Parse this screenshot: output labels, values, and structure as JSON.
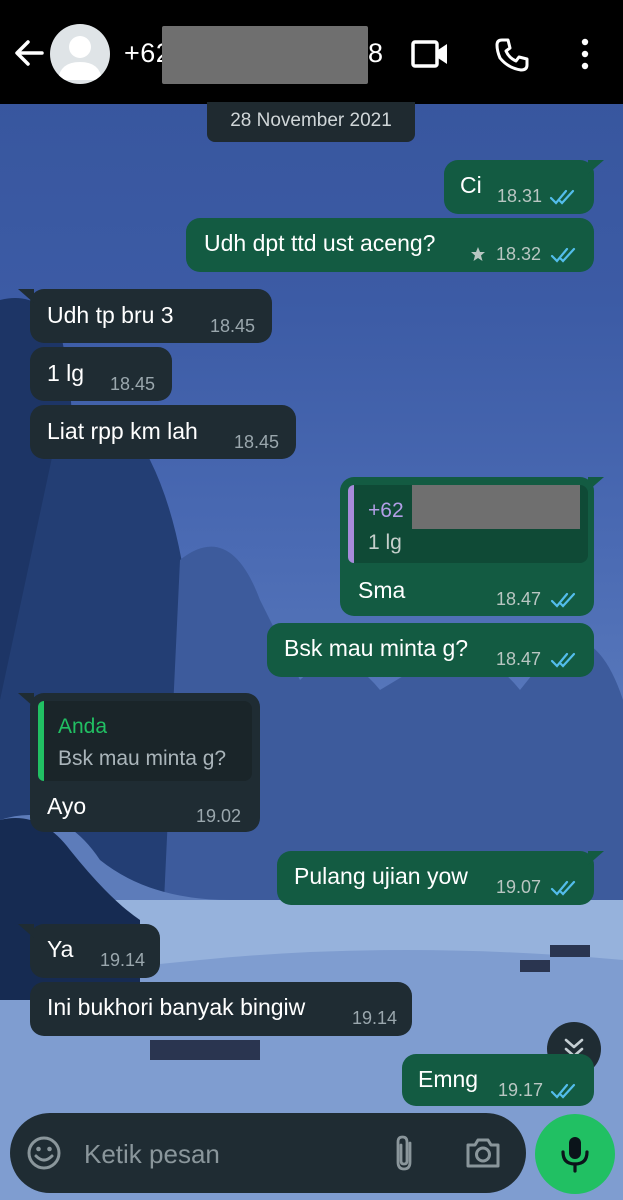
{
  "header": {
    "contact_prefix": "+62",
    "contact_suffix": "8"
  },
  "date_chip": "28 November 2021",
  "messages": [
    {
      "text": "Ci",
      "time": "18.31"
    },
    {
      "text": "Udh dpt ttd ust aceng?",
      "time": "18.32",
      "starred": true
    },
    {
      "text": "Udh tp bru 3",
      "time": "18.45"
    },
    {
      "text": "1 lg",
      "time": "18.45"
    },
    {
      "text": "Liat rpp km lah",
      "time": "18.45"
    },
    {
      "quote_author": "+62",
      "quote_text": "1 lg",
      "text": "Sma",
      "time": "18.47"
    },
    {
      "text": "Bsk mau minta g?",
      "time": "18.47"
    },
    {
      "quote_author": "Anda",
      "quote_text": "Bsk mau minta g?",
      "text": "Ayo",
      "time": "19.02"
    },
    {
      "text": "Pulang ujian yow",
      "time": "19.07"
    },
    {
      "text": "Ya",
      "time": "19.14"
    },
    {
      "text": "Ini bukhori banyak bingiw",
      "time": "19.14"
    },
    {
      "text": "Emng",
      "time": "19.17"
    }
  ],
  "composer": {
    "placeholder": "Ketik pesan"
  },
  "colors": {
    "outgoing_bubble": "#135b42",
    "incoming_bubble": "#1f2c33",
    "read_ticks": "#53bdeb",
    "accent_green": "#21c063"
  },
  "icons": [
    "back-arrow-icon",
    "video-call-icon",
    "voice-call-icon",
    "more-options-icon",
    "emoji-icon",
    "attach-icon",
    "camera-icon",
    "microphone-icon",
    "chevron-double-down-icon",
    "star-icon",
    "double-check-icon"
  ]
}
